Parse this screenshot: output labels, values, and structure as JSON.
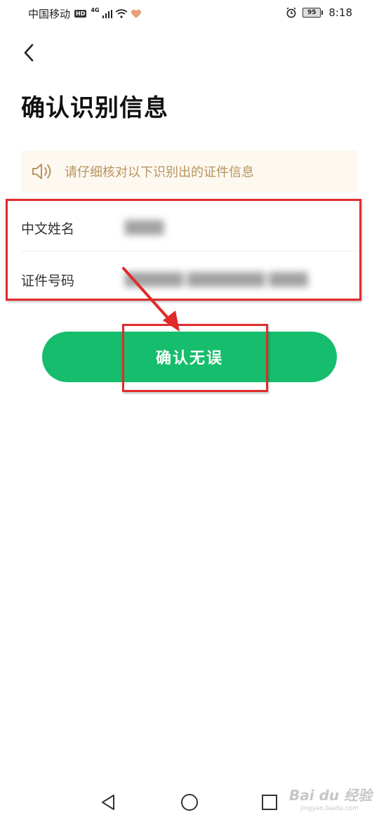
{
  "status_bar": {
    "carrier": "中国移动",
    "hd": "HD",
    "network": "4G",
    "battery": "95",
    "time": "8:18"
  },
  "header": {
    "back_icon": "chevron-left-icon",
    "title": "确认识别信息"
  },
  "notice": {
    "icon": "speaker-icon",
    "text": "请仔细核对以下识别出的证件信息"
  },
  "fields": [
    {
      "label": "中文姓名",
      "value": "████"
    },
    {
      "label": "证件号码",
      "value": "██████ ████████ ████"
    }
  ],
  "confirm_button": {
    "label": "确认无误"
  },
  "nav_bar": {
    "back_icon": "triangle-back-icon",
    "home_icon": "circle-home-icon",
    "recent_icon": "square-recent-icon"
  },
  "watermark": {
    "main": "Bai du 经验",
    "sub": "jingyan.baidu.com"
  },
  "colors": {
    "accent": "#16bd6c",
    "notice_bg": "#fdf8f0",
    "notice_text": "#b7945e",
    "annotation": "#e12b2b"
  }
}
